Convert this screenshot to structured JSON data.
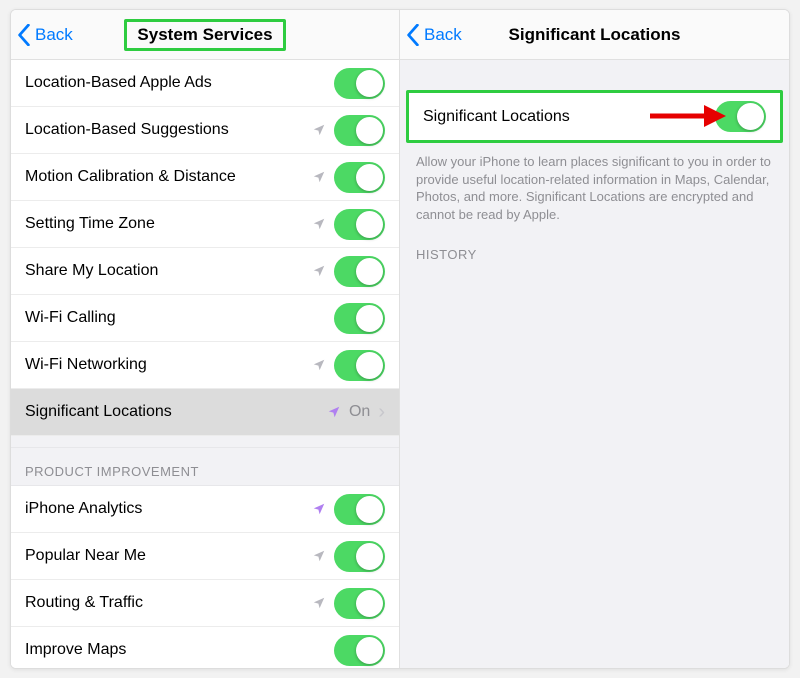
{
  "left": {
    "back_label": "Back",
    "title": "System Services",
    "rows": [
      {
        "label": "Location-Based Apple Ads",
        "arrow": false,
        "purple": false,
        "toggle": true
      },
      {
        "label": "Location-Based Suggestions",
        "arrow": true,
        "purple": false,
        "toggle": true
      },
      {
        "label": "Motion Calibration & Distance",
        "arrow": true,
        "purple": false,
        "toggle": true
      },
      {
        "label": "Setting Time Zone",
        "arrow": true,
        "purple": false,
        "toggle": true
      },
      {
        "label": "Share My Location",
        "arrow": true,
        "purple": false,
        "toggle": true
      },
      {
        "label": "Wi-Fi Calling",
        "arrow": false,
        "purple": false,
        "toggle": true
      },
      {
        "label": "Wi-Fi Networking",
        "arrow": true,
        "purple": false,
        "toggle": true
      }
    ],
    "link_row": {
      "label": "Significant Locations",
      "status": "On"
    },
    "section_header": "PRODUCT IMPROVEMENT",
    "rows2": [
      {
        "label": "iPhone Analytics",
        "arrow": true,
        "purple": true,
        "toggle": true
      },
      {
        "label": "Popular Near Me",
        "arrow": true,
        "purple": false,
        "toggle": true
      },
      {
        "label": "Routing & Traffic",
        "arrow": true,
        "purple": false,
        "toggle": true
      },
      {
        "label": "Improve Maps",
        "arrow": false,
        "purple": false,
        "toggle": true
      }
    ]
  },
  "right": {
    "back_label": "Back",
    "title": "Significant Locations",
    "toggle_row": {
      "label": "Significant Locations"
    },
    "description": "Allow your iPhone to learn places significant to you in order to provide useful location-related information in Maps, Calendar, Photos, and more. Significant Locations are encrypted and cannot be read by Apple.",
    "history_header": "HISTORY"
  }
}
